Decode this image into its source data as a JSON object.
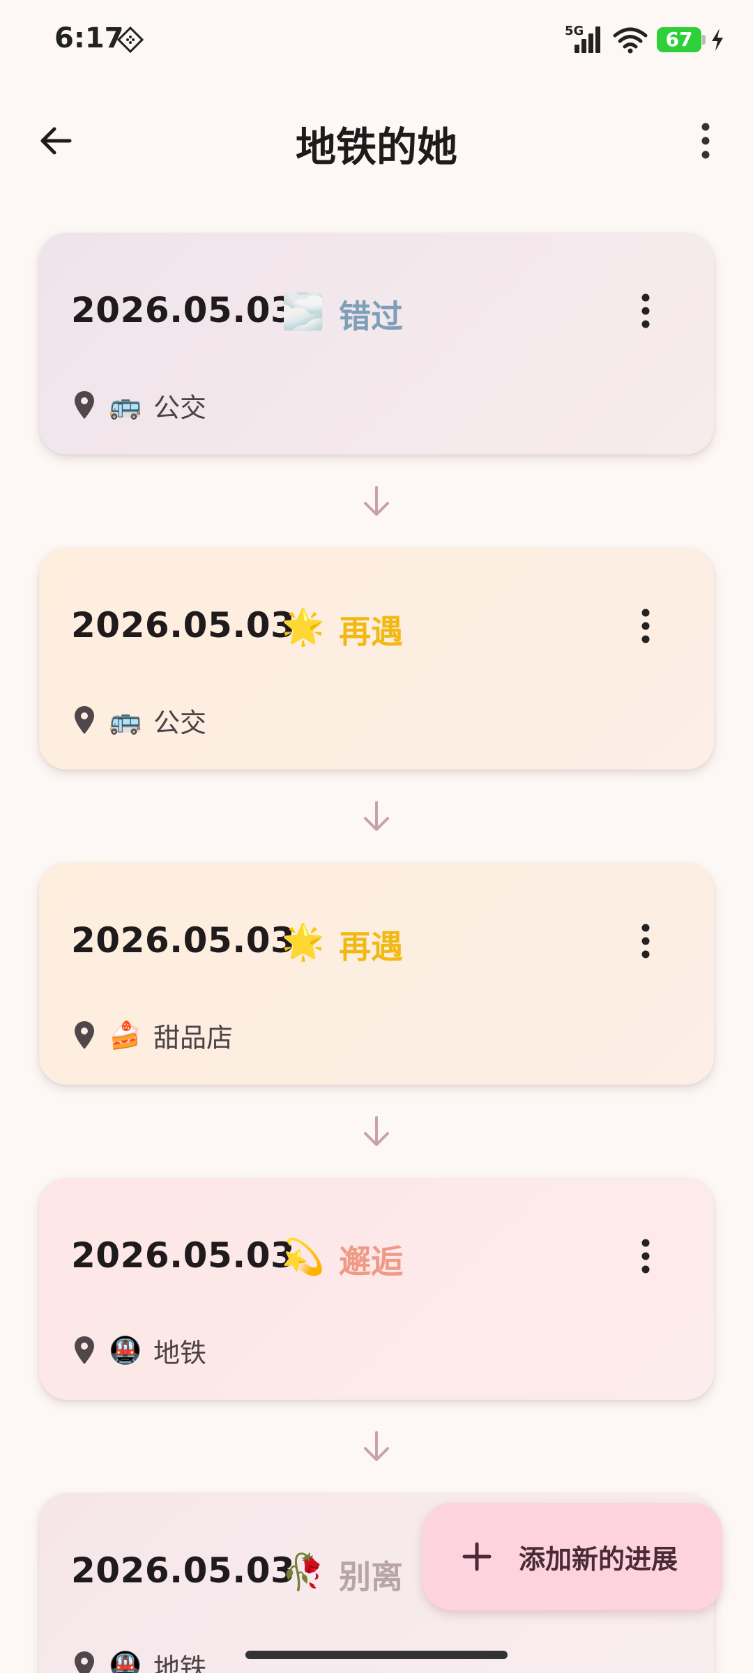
{
  "status_bar": {
    "time": "6:17",
    "network": "5G",
    "battery": "67",
    "icons": [
      "notification-icon",
      "signal-icon",
      "wifi-icon",
      "battery-icon",
      "charging-icon"
    ]
  },
  "app_bar": {
    "title": "地铁的她",
    "back_icon": "arrow-back-icon",
    "more_icon": "more-vert-icon"
  },
  "entries": [
    {
      "date": "2026.05.03",
      "status_emoji": "🌫️",
      "status_label": "错过",
      "status_color": "#7e9fb8",
      "location_icon": "🚌",
      "location": "公交"
    },
    {
      "date": "2026.05.03",
      "status_emoji": "🌟",
      "status_label": "再遇",
      "status_color": "#f2b915",
      "location_icon": "🚌",
      "location": "公交"
    },
    {
      "date": "2026.05.03",
      "status_emoji": "🌟",
      "status_label": "再遇",
      "status_color": "#f2b915",
      "location_icon": "🍰",
      "location": "甜品店"
    },
    {
      "date": "2026.05.03",
      "status_emoji": "💫",
      "status_label": "邂逅",
      "status_color": "#ef9a86",
      "location_icon": "🚇",
      "location": "地铁"
    },
    {
      "date": "2026.05.03",
      "status_emoji": "🥀",
      "status_label": "别离",
      "status_color": "#b7a5a8",
      "location_icon": "🚇",
      "location": "地铁"
    }
  ],
  "fab": {
    "label": "添加新的进展",
    "icon": "plus-icon"
  },
  "colors": {
    "background": "#fdf8f5",
    "arrow": "#c7a2ad",
    "fab": "#fcd3de"
  }
}
